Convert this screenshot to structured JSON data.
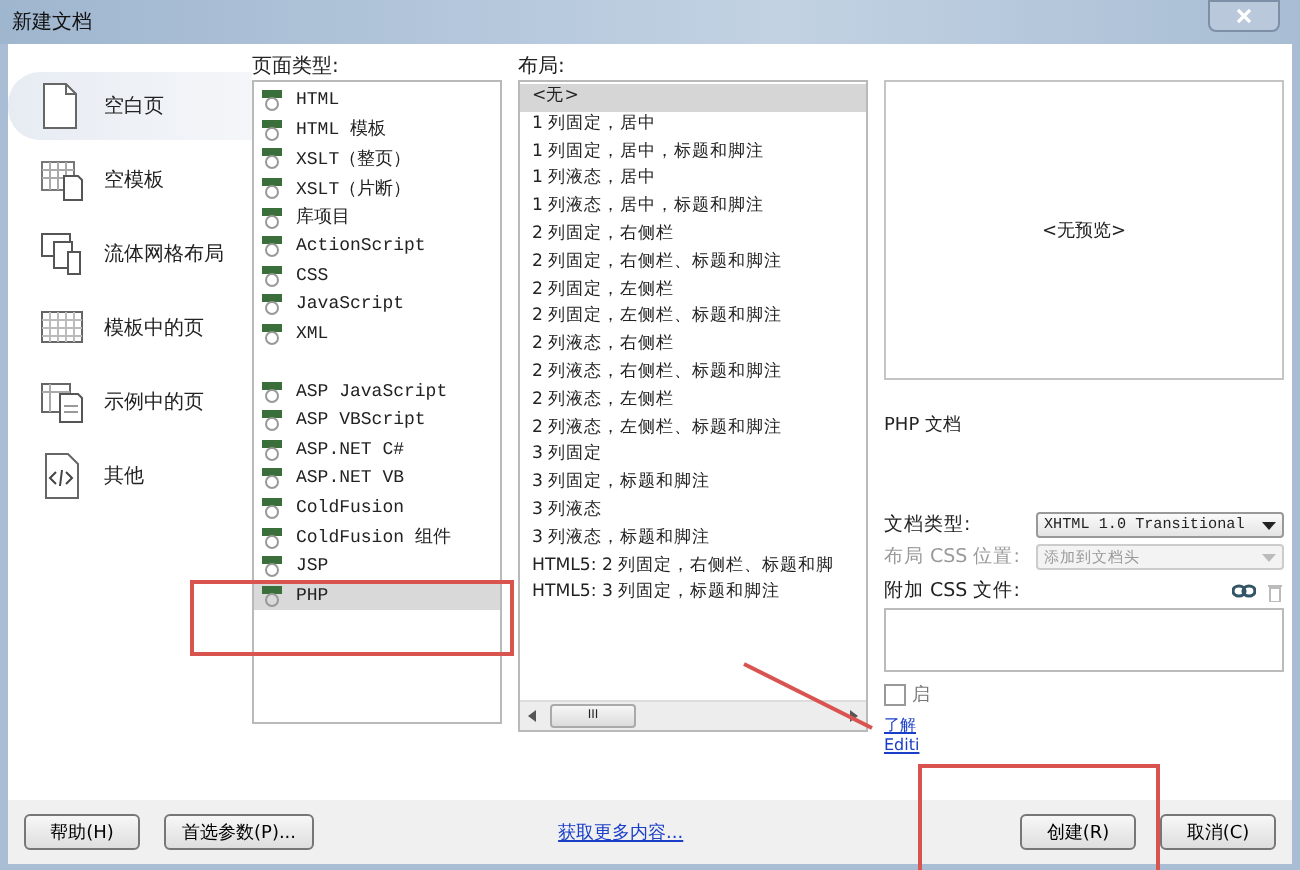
{
  "window": {
    "title": "新建文档"
  },
  "categories": [
    {
      "label": "空白页",
      "selected": true
    },
    {
      "label": "空模板",
      "selected": false
    },
    {
      "label": "流体网格布局",
      "selected": false
    },
    {
      "label": "模板中的页",
      "selected": false
    },
    {
      "label": "示例中的页",
      "selected": false
    },
    {
      "label": "其他",
      "selected": false
    }
  ],
  "page_types": {
    "label": "页面类型:",
    "groups": [
      [
        {
          "label": "HTML",
          "selected": false
        },
        {
          "label": "HTML 模板",
          "selected": false
        },
        {
          "label": "XSLT（整页）",
          "selected": false
        },
        {
          "label": "XSLT（片断）",
          "selected": false
        },
        {
          "label": "库项目",
          "selected": false
        },
        {
          "label": "ActionScript",
          "selected": false
        },
        {
          "label": "CSS",
          "selected": false
        },
        {
          "label": "JavaScript",
          "selected": false
        },
        {
          "label": "XML",
          "selected": false
        }
      ],
      [
        {
          "label": "ASP JavaScript",
          "selected": false
        },
        {
          "label": "ASP VBScript",
          "selected": false
        },
        {
          "label": "ASP.NET C#",
          "selected": false
        },
        {
          "label": "ASP.NET VB",
          "selected": false
        },
        {
          "label": "ColdFusion",
          "selected": false
        },
        {
          "label": "ColdFusion 组件",
          "selected": false
        },
        {
          "label": "JSP",
          "selected": false
        },
        {
          "label": "PHP",
          "selected": true
        }
      ]
    ]
  },
  "layouts": {
    "label": "布局:",
    "items": [
      {
        "label": "<无>",
        "selected": true
      },
      {
        "label": "1 列固定，居中",
        "selected": false
      },
      {
        "label": "1 列固定，居中，标题和脚注",
        "selected": false
      },
      {
        "label": "1 列液态，居中",
        "selected": false
      },
      {
        "label": "1 列液态，居中，标题和脚注",
        "selected": false
      },
      {
        "label": "2 列固定，右侧栏",
        "selected": false
      },
      {
        "label": "2 列固定，右侧栏、标题和脚注",
        "selected": false
      },
      {
        "label": "2 列固定，左侧栏",
        "selected": false
      },
      {
        "label": "2 列固定，左侧栏、标题和脚注",
        "selected": false
      },
      {
        "label": "2 列液态，右侧栏",
        "selected": false
      },
      {
        "label": "2 列液态，右侧栏、标题和脚注",
        "selected": false
      },
      {
        "label": "2 列液态，左侧栏",
        "selected": false
      },
      {
        "label": "2 列液态，左侧栏、标题和脚注",
        "selected": false
      },
      {
        "label": "3 列固定",
        "selected": false
      },
      {
        "label": "3 列固定，标题和脚注",
        "selected": false
      },
      {
        "label": "3 列液态",
        "selected": false
      },
      {
        "label": "3 列液态，标题和脚注",
        "selected": false
      },
      {
        "label": "HTML5: 2 列固定，右侧栏、标题和脚",
        "selected": false
      },
      {
        "label": "HTML5: 3 列固定，标题和脚注",
        "selected": false
      }
    ],
    "scrollbar_grip": "III"
  },
  "preview": {
    "text": "<无预览>",
    "description": "PHP 文档"
  },
  "options": [
    {
      "label": "文档类型:",
      "value": "XHTML 1.0 Transitional",
      "disabled": false
    },
    {
      "label": "布局 CSS 位置:",
      "value": "添加到文档头",
      "disabled": true
    }
  ],
  "attach_css": {
    "label": "附加 CSS 文件:"
  },
  "checkbox": {
    "label": "启",
    "checked": false
  },
  "links": [
    "了解",
    "Editi"
  ],
  "footer": {
    "left_buttons": [
      "帮助(H)",
      "首选参数(P)..."
    ],
    "link": "获取更多内容...",
    "right_buttons": [
      "创建(R)",
      "取消(C)"
    ]
  }
}
